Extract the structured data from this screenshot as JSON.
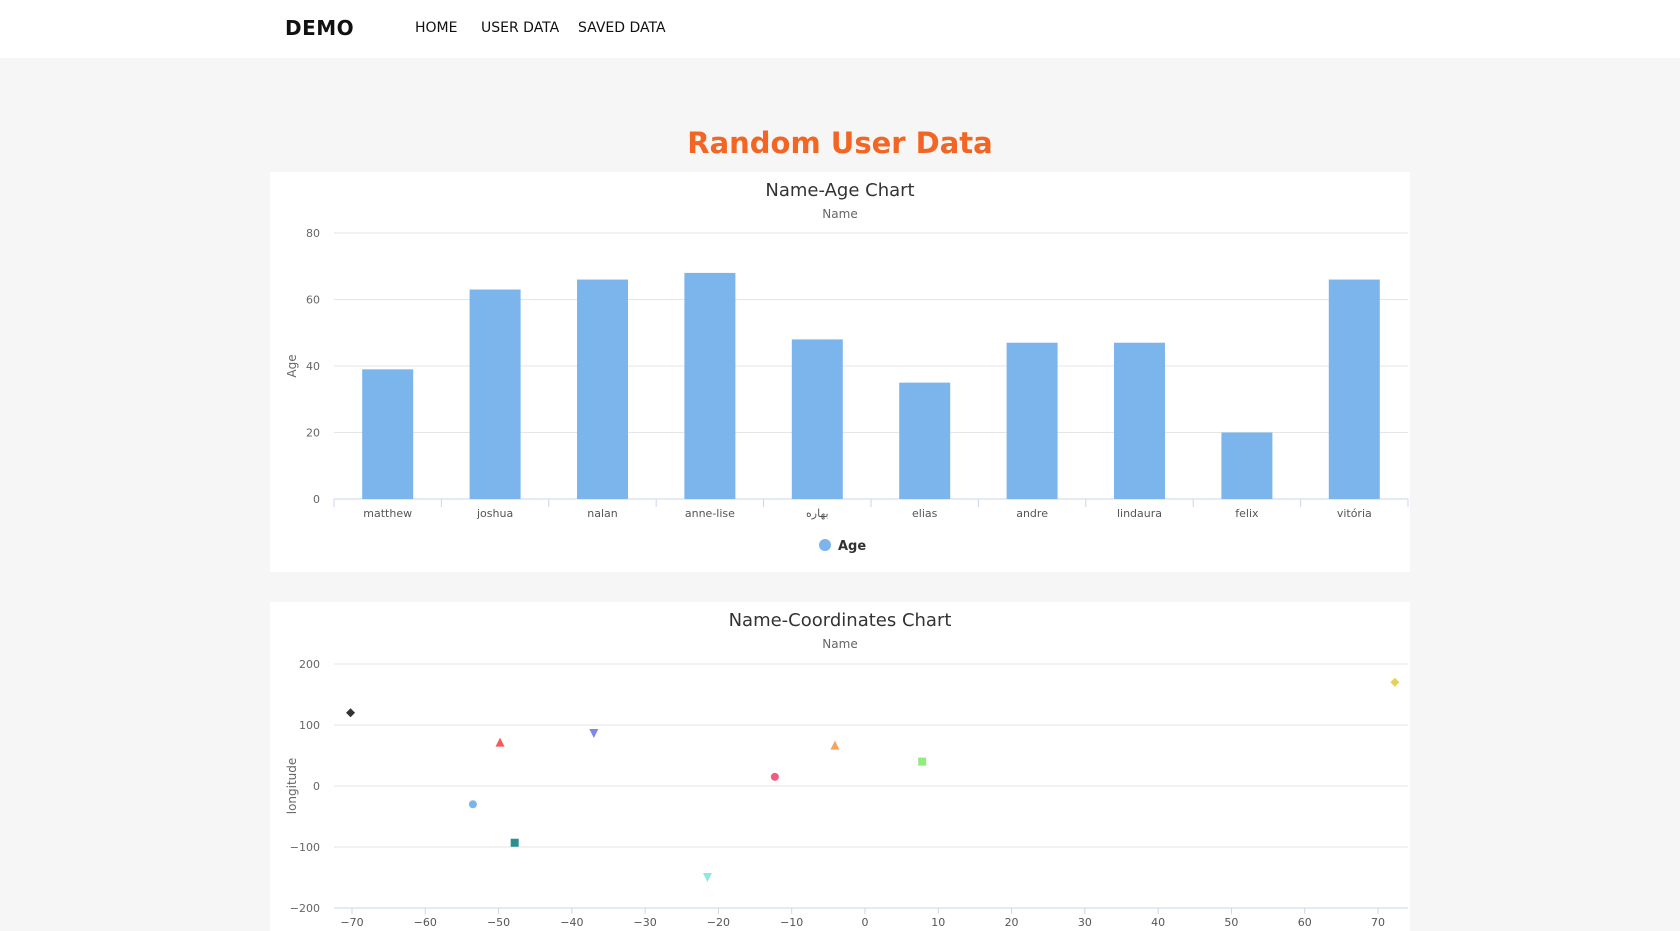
{
  "nav": {
    "brand": "DEMO",
    "links": [
      "HOME",
      "USER DATA",
      "SAVED DATA"
    ]
  },
  "page": {
    "title": "Random User Data"
  },
  "colors": {
    "title": "#f26522",
    "bar": "#7cb5ec"
  },
  "chart_data": [
    {
      "type": "bar",
      "title": "Name-Age Chart",
      "subtitle": "Name",
      "ylabel": "Age",
      "ylim": [
        0,
        80
      ],
      "yticks": [
        0,
        20,
        40,
        60,
        80
      ],
      "categories": [
        "matthew",
        "joshua",
        "nalan",
        "anne-lise",
        "بهاره",
        "elias",
        "andre",
        "lindaura",
        "felix",
        "vitória"
      ],
      "series": [
        {
          "name": "Age",
          "values": [
            39,
            63,
            66,
            68,
            48,
            35,
            47,
            47,
            20,
            66
          ]
        }
      ],
      "legend": "bottom-center",
      "grid": true
    },
    {
      "type": "scatter",
      "title": "Name-Coordinates Chart",
      "subtitle": "Name",
      "ylabel": "longitude",
      "xlim": [
        -70,
        70
      ],
      "ylim": [
        -200,
        200
      ],
      "xticks": [
        -70,
        -60,
        -50,
        -40,
        -30,
        -20,
        -10,
        0,
        10,
        20,
        30,
        40,
        50,
        60,
        70
      ],
      "yticks": [
        200,
        100,
        0,
        -100,
        -200
      ],
      "grid": true,
      "points": [
        {
          "x": -70.2,
          "y": 120,
          "color": "#333333",
          "marker": "diamond"
        },
        {
          "x": -53.5,
          "y": -30,
          "color": "#7cb5ec",
          "marker": "circle"
        },
        {
          "x": -49.8,
          "y": 72,
          "color": "#f45b5b",
          "marker": "triangle"
        },
        {
          "x": -47.8,
          "y": -93,
          "color": "#2b908f",
          "marker": "square"
        },
        {
          "x": -37,
          "y": 86,
          "color": "#8085e9",
          "marker": "triangle-down"
        },
        {
          "x": -21.5,
          "y": -150,
          "color": "#91e8e1",
          "marker": "triangle-down"
        },
        {
          "x": -12.3,
          "y": 15,
          "color": "#f15c80",
          "marker": "circle"
        },
        {
          "x": -4.1,
          "y": 67,
          "color": "#f7a35c",
          "marker": "triangle"
        },
        {
          "x": 7.8,
          "y": 40,
          "color": "#90ed7d",
          "marker": "square"
        },
        {
          "x": 72.3,
          "y": 170,
          "color": "#e4d354",
          "marker": "diamond"
        }
      ]
    }
  ]
}
